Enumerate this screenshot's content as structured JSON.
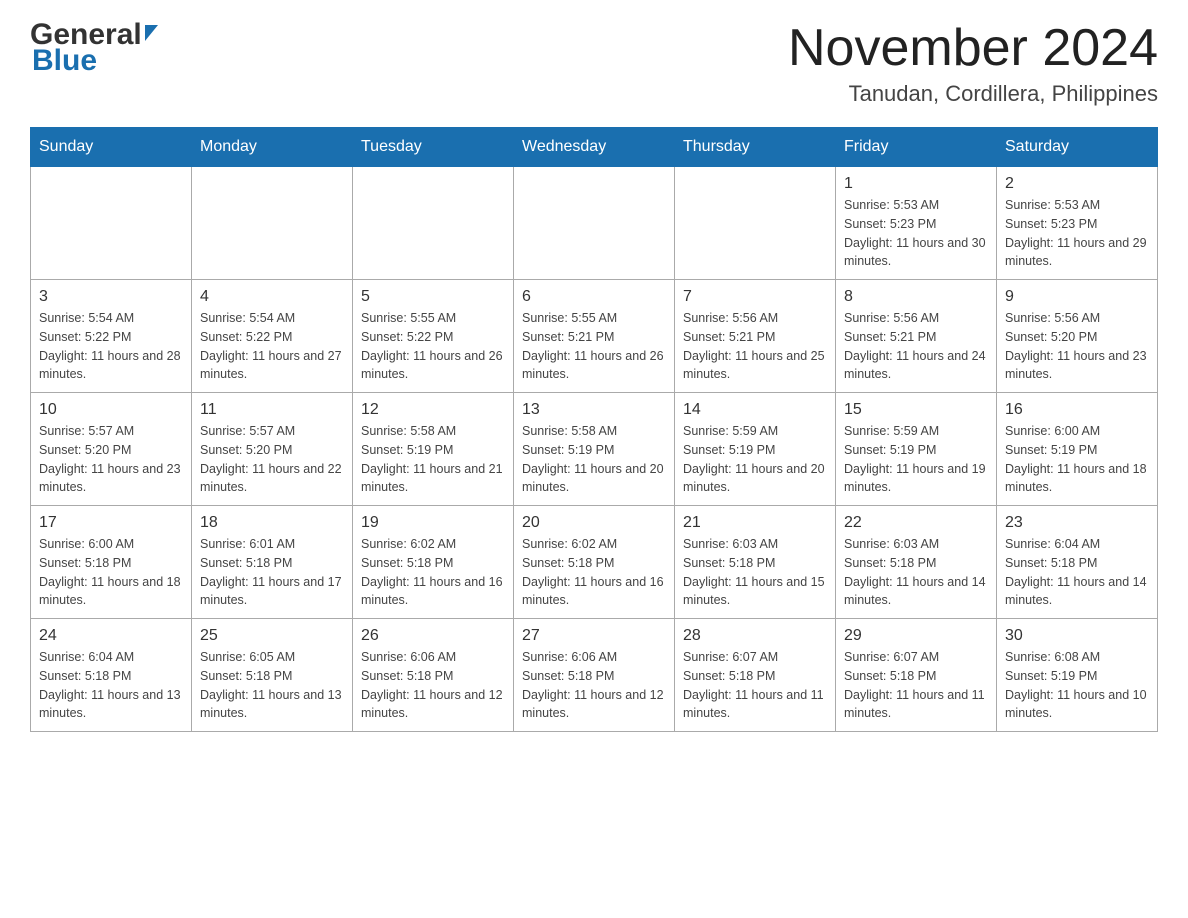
{
  "header": {
    "logo_general": "General",
    "logo_blue": "Blue",
    "month_title": "November 2024",
    "location": "Tanudan, Cordillera, Philippines"
  },
  "calendar": {
    "days_of_week": [
      "Sunday",
      "Monday",
      "Tuesday",
      "Wednesday",
      "Thursday",
      "Friday",
      "Saturday"
    ],
    "weeks": [
      [
        {
          "day": "",
          "info": ""
        },
        {
          "day": "",
          "info": ""
        },
        {
          "day": "",
          "info": ""
        },
        {
          "day": "",
          "info": ""
        },
        {
          "day": "",
          "info": ""
        },
        {
          "day": "1",
          "info": "Sunrise: 5:53 AM\nSunset: 5:23 PM\nDaylight: 11 hours and 30 minutes."
        },
        {
          "day": "2",
          "info": "Sunrise: 5:53 AM\nSunset: 5:23 PM\nDaylight: 11 hours and 29 minutes."
        }
      ],
      [
        {
          "day": "3",
          "info": "Sunrise: 5:54 AM\nSunset: 5:22 PM\nDaylight: 11 hours and 28 minutes."
        },
        {
          "day": "4",
          "info": "Sunrise: 5:54 AM\nSunset: 5:22 PM\nDaylight: 11 hours and 27 minutes."
        },
        {
          "day": "5",
          "info": "Sunrise: 5:55 AM\nSunset: 5:22 PM\nDaylight: 11 hours and 26 minutes."
        },
        {
          "day": "6",
          "info": "Sunrise: 5:55 AM\nSunset: 5:21 PM\nDaylight: 11 hours and 26 minutes."
        },
        {
          "day": "7",
          "info": "Sunrise: 5:56 AM\nSunset: 5:21 PM\nDaylight: 11 hours and 25 minutes."
        },
        {
          "day": "8",
          "info": "Sunrise: 5:56 AM\nSunset: 5:21 PM\nDaylight: 11 hours and 24 minutes."
        },
        {
          "day": "9",
          "info": "Sunrise: 5:56 AM\nSunset: 5:20 PM\nDaylight: 11 hours and 23 minutes."
        }
      ],
      [
        {
          "day": "10",
          "info": "Sunrise: 5:57 AM\nSunset: 5:20 PM\nDaylight: 11 hours and 23 minutes."
        },
        {
          "day": "11",
          "info": "Sunrise: 5:57 AM\nSunset: 5:20 PM\nDaylight: 11 hours and 22 minutes."
        },
        {
          "day": "12",
          "info": "Sunrise: 5:58 AM\nSunset: 5:19 PM\nDaylight: 11 hours and 21 minutes."
        },
        {
          "day": "13",
          "info": "Sunrise: 5:58 AM\nSunset: 5:19 PM\nDaylight: 11 hours and 20 minutes."
        },
        {
          "day": "14",
          "info": "Sunrise: 5:59 AM\nSunset: 5:19 PM\nDaylight: 11 hours and 20 minutes."
        },
        {
          "day": "15",
          "info": "Sunrise: 5:59 AM\nSunset: 5:19 PM\nDaylight: 11 hours and 19 minutes."
        },
        {
          "day": "16",
          "info": "Sunrise: 6:00 AM\nSunset: 5:19 PM\nDaylight: 11 hours and 18 minutes."
        }
      ],
      [
        {
          "day": "17",
          "info": "Sunrise: 6:00 AM\nSunset: 5:18 PM\nDaylight: 11 hours and 18 minutes."
        },
        {
          "day": "18",
          "info": "Sunrise: 6:01 AM\nSunset: 5:18 PM\nDaylight: 11 hours and 17 minutes."
        },
        {
          "day": "19",
          "info": "Sunrise: 6:02 AM\nSunset: 5:18 PM\nDaylight: 11 hours and 16 minutes."
        },
        {
          "day": "20",
          "info": "Sunrise: 6:02 AM\nSunset: 5:18 PM\nDaylight: 11 hours and 16 minutes."
        },
        {
          "day": "21",
          "info": "Sunrise: 6:03 AM\nSunset: 5:18 PM\nDaylight: 11 hours and 15 minutes."
        },
        {
          "day": "22",
          "info": "Sunrise: 6:03 AM\nSunset: 5:18 PM\nDaylight: 11 hours and 14 minutes."
        },
        {
          "day": "23",
          "info": "Sunrise: 6:04 AM\nSunset: 5:18 PM\nDaylight: 11 hours and 14 minutes."
        }
      ],
      [
        {
          "day": "24",
          "info": "Sunrise: 6:04 AM\nSunset: 5:18 PM\nDaylight: 11 hours and 13 minutes."
        },
        {
          "day": "25",
          "info": "Sunrise: 6:05 AM\nSunset: 5:18 PM\nDaylight: 11 hours and 13 minutes."
        },
        {
          "day": "26",
          "info": "Sunrise: 6:06 AM\nSunset: 5:18 PM\nDaylight: 11 hours and 12 minutes."
        },
        {
          "day": "27",
          "info": "Sunrise: 6:06 AM\nSunset: 5:18 PM\nDaylight: 11 hours and 12 minutes."
        },
        {
          "day": "28",
          "info": "Sunrise: 6:07 AM\nSunset: 5:18 PM\nDaylight: 11 hours and 11 minutes."
        },
        {
          "day": "29",
          "info": "Sunrise: 6:07 AM\nSunset: 5:18 PM\nDaylight: 11 hours and 11 minutes."
        },
        {
          "day": "30",
          "info": "Sunrise: 6:08 AM\nSunset: 5:19 PM\nDaylight: 11 hours and 10 minutes."
        }
      ]
    ]
  }
}
